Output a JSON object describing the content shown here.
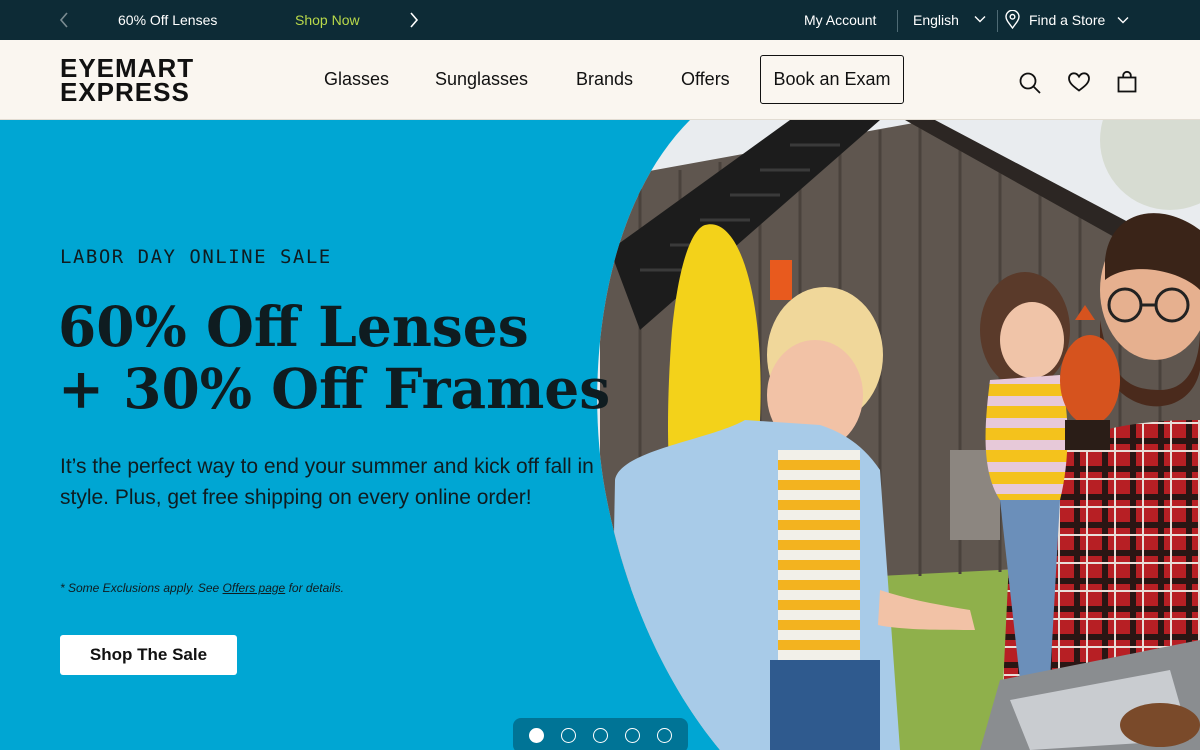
{
  "promo_bar": {
    "message": "60% Off Lenses",
    "link_label": "Shop Now",
    "account_label": "My Account",
    "language_label": "English",
    "store_label": "Find a Store"
  },
  "header": {
    "logo_line1": "EYEMART",
    "logo_line2": "EXPRESS",
    "nav": [
      {
        "label": "Glasses"
      },
      {
        "label": "Sunglasses"
      },
      {
        "label": "Brands"
      },
      {
        "label": "Offers"
      }
    ],
    "exam_button_label": "Book an Exam",
    "icons": [
      "search-icon",
      "heart-icon",
      "shopping-bag-icon"
    ]
  },
  "hero": {
    "eyebrow": "LABOR DAY ONLINE SALE",
    "headline_line1": "60% Off Lenses",
    "headline_line2": "+ 30% Off Frames",
    "body": "It’s the perfect way to end your summer and kick off fall in style. Plus, get free shipping on every online order!",
    "fine_print_prefix": "* Some Exclusions apply. See ",
    "fine_print_link": "Offers page",
    "fine_print_suffix": " for details.",
    "cta_label": "Shop The Sale",
    "carousel": {
      "slide_count": 5,
      "active_slide": 1
    }
  },
  "colors": {
    "promo_bg": "#0d2b36",
    "promo_link": "#b9d94a",
    "header_bg": "#faf6f0",
    "hero_bg": "#00a6d3"
  }
}
